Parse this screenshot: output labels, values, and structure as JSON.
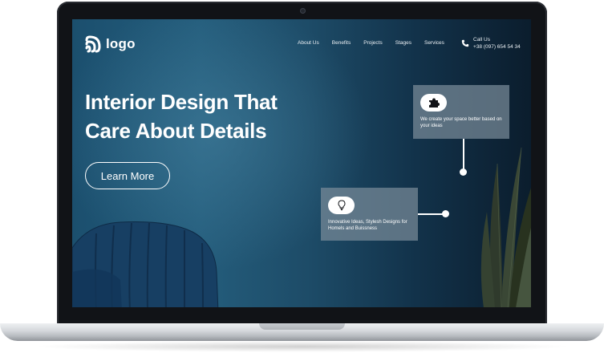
{
  "brand": {
    "logo_text": "logo",
    "logo_icon": "wave-logo-icon"
  },
  "nav": {
    "items": [
      "About Us",
      "Benefits",
      "Projects",
      "Stages",
      "Services"
    ]
  },
  "contact": {
    "label": "Call Us",
    "phone": "+38 (097) 654 54 34",
    "icon": "phone-icon"
  },
  "hero": {
    "headline_line1": "Interior Design That",
    "headline_line2": "Care About Details",
    "cta_label": "Learn More"
  },
  "cards": [
    {
      "icon": "puzzle-icon",
      "text": "We create your space better based on your ideas"
    },
    {
      "icon": "lightbulb-icon",
      "text": "Innovative Ideas, Stylesh Designs for Homels and Buissness"
    }
  ],
  "colors": {
    "hero_bg_left": "#245d7c",
    "hero_bg_right": "#0b1d2d",
    "card_bg": "#788a98",
    "text": "#ffffff"
  }
}
